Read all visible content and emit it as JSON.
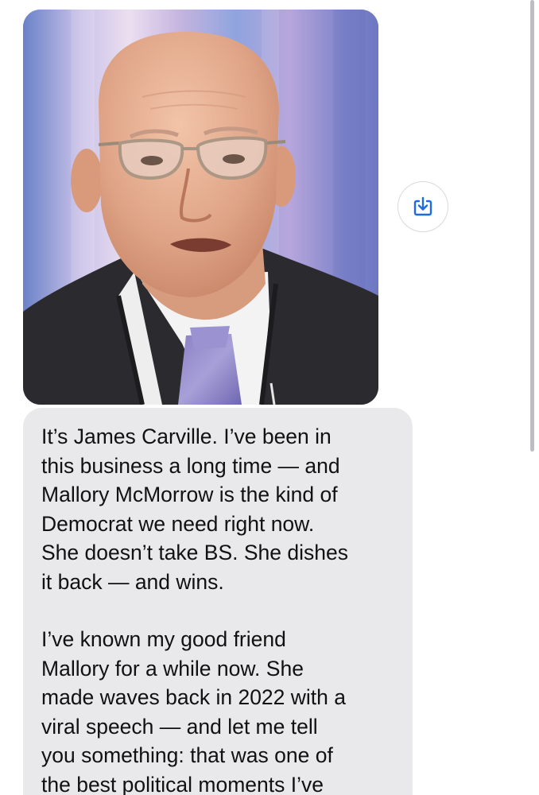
{
  "conversation": {
    "image_message": {
      "subject": "portrait photo of a bald man with glasses in a dark suit and tie"
    },
    "save_button": {
      "icon": "download-to-photos-icon",
      "accent_color": "#1c6be2"
    },
    "text_message": {
      "paragraphs": [
        "It’s James Carville. I’ve been in\nthis business a long time — and\nMallory McMorrow is the kind of\nDemocrat we need right now.\nShe doesn’t take BS. She dishes\nit back — and wins.",
        "I’ve known my good friend\nMallory for a while now. She\nmade waves back in 2022 with a\nviral speech — and let me tell\nyou something: that was one of\nthe best political moments I’ve"
      ],
      "bubble_color": "#e9e9eb"
    }
  }
}
